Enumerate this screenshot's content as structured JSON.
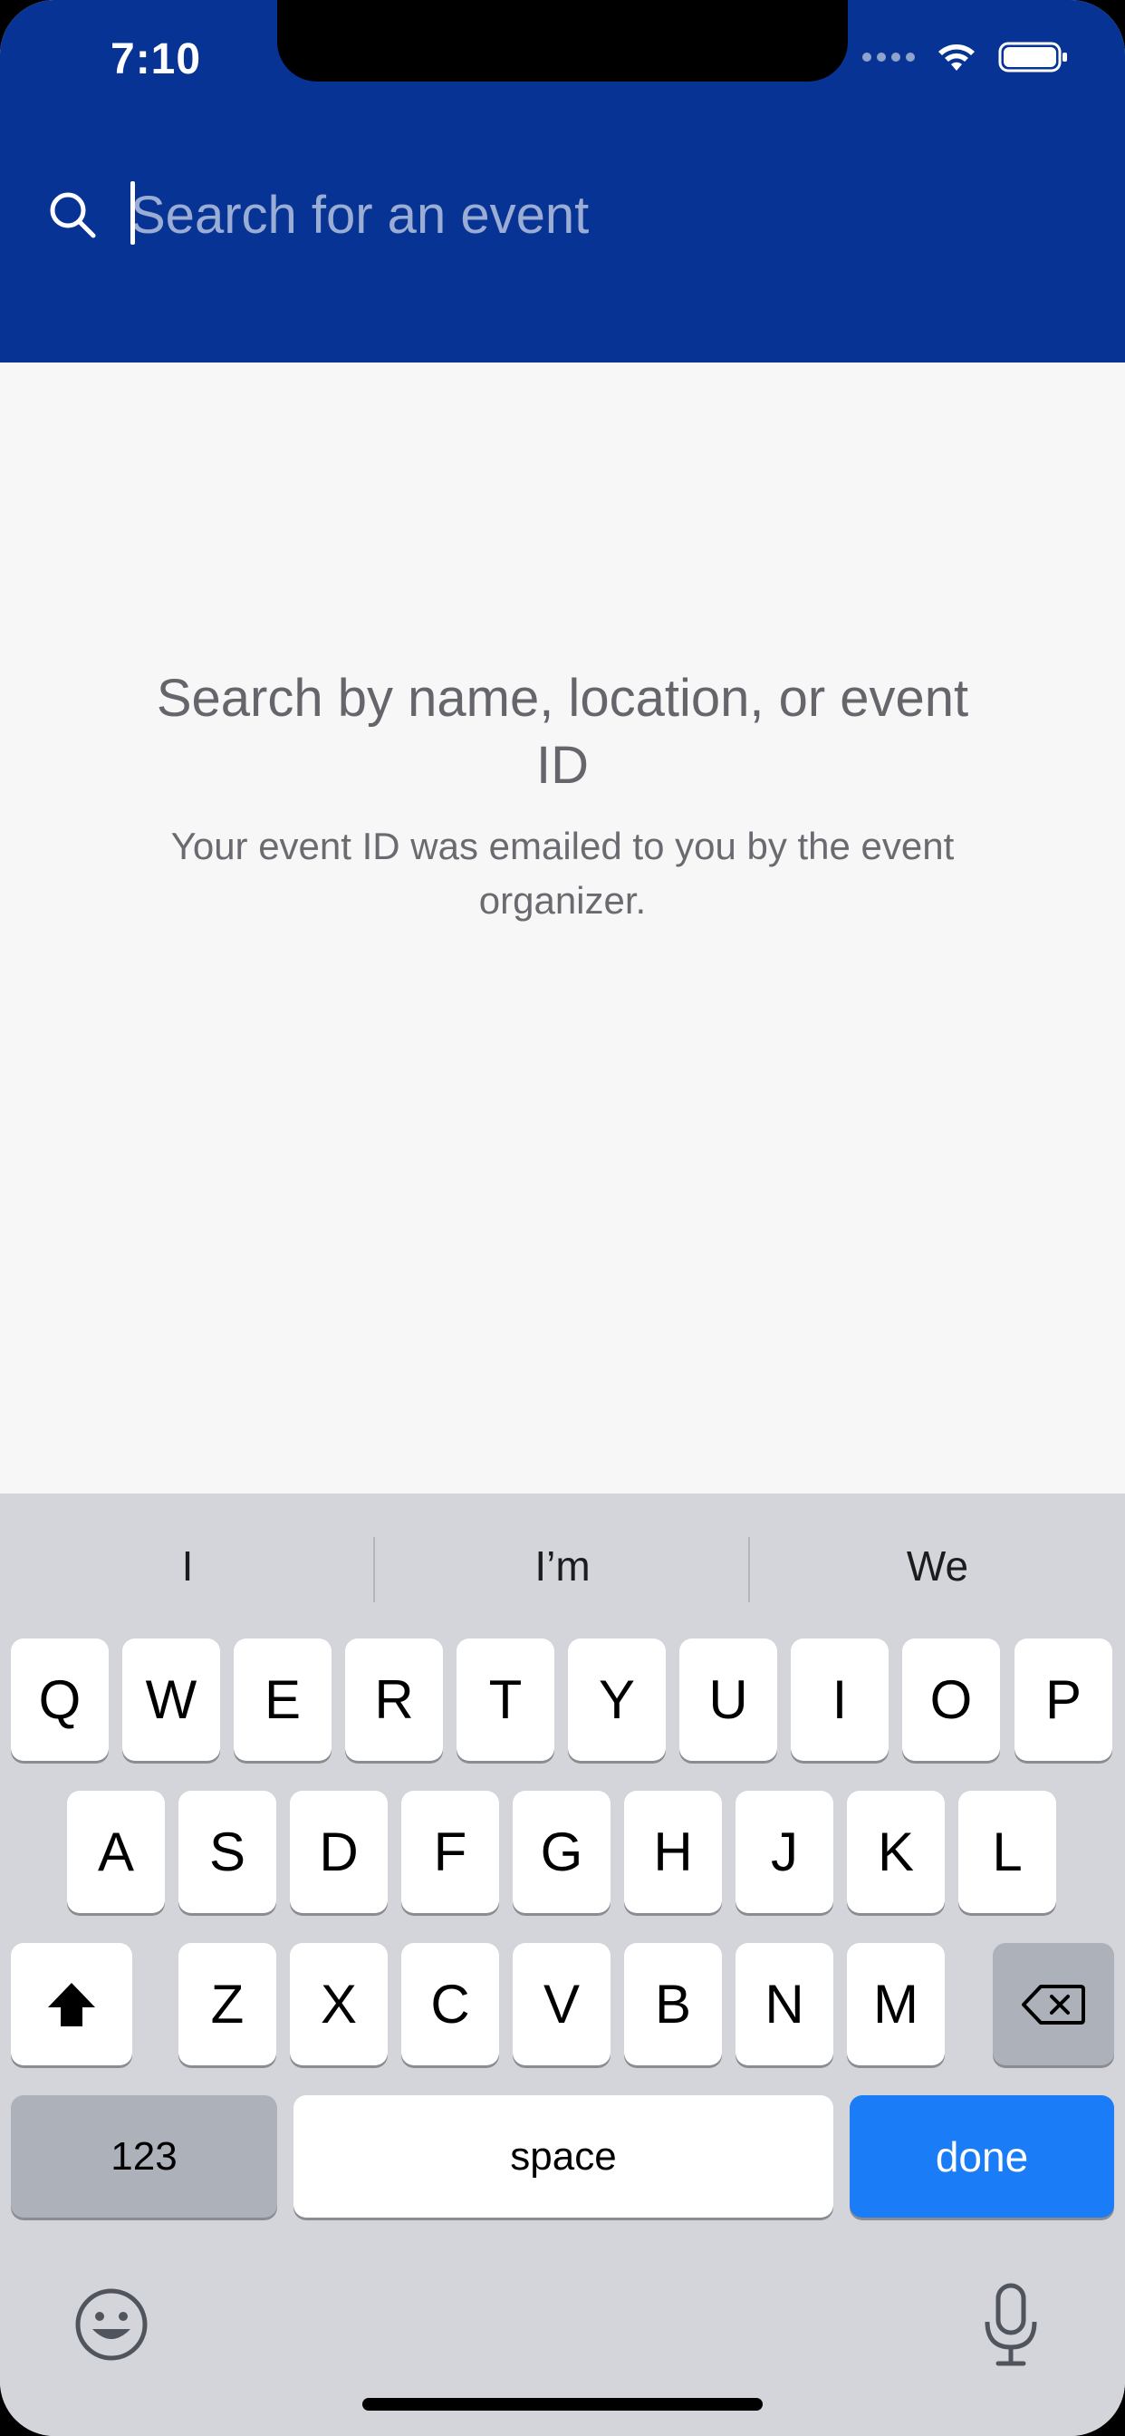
{
  "status_bar": {
    "time": "7:10"
  },
  "search": {
    "placeholder": "Search for an event",
    "value": ""
  },
  "empty_state": {
    "title": "Search by name, location, or event ID",
    "subtitle": "Your event ID was emailed to you by the event organizer."
  },
  "keyboard": {
    "suggestions": [
      "I",
      "I’m",
      "We"
    ],
    "row1": [
      "Q",
      "W",
      "E",
      "R",
      "T",
      "Y",
      "U",
      "I",
      "O",
      "P"
    ],
    "row2": [
      "A",
      "S",
      "D",
      "F",
      "G",
      "H",
      "J",
      "K",
      "L"
    ],
    "row3": [
      "Z",
      "X",
      "C",
      "V",
      "B",
      "N",
      "M"
    ],
    "numbers_label": "123",
    "space_label": "space",
    "done_label": "done"
  },
  "colors": {
    "header_bg": "#073494",
    "page_bg": "#f7f7f7",
    "keyboard_bg": "#d3d5db",
    "done_key": "#1a7cf7"
  }
}
